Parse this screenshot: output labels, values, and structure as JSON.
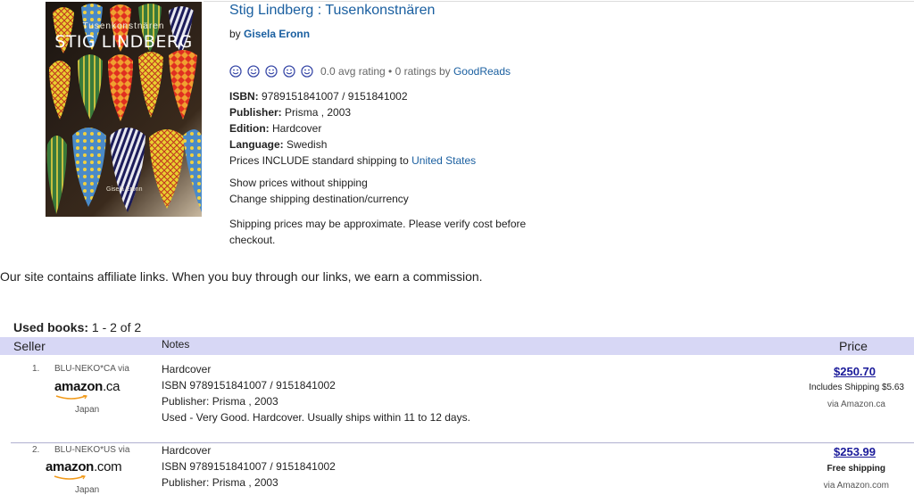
{
  "cover": {
    "subtitle": "Tusenkonstnären",
    "title": "STIG LINDBERG",
    "publisher_mark": "Gisela Eronn"
  },
  "book": {
    "title": "Stig Lindberg : Tusenkonstnären",
    "by_label": "by",
    "author": "Gisela Eronn",
    "rating_text": "0.0 avg rating • 0 ratings by",
    "rating_source": "GoodReads",
    "isbn_label": "ISBN:",
    "isbn": "9789151841007 / 9151841002",
    "publisher_label": "Publisher:",
    "publisher": "Prisma , 2003",
    "edition_label": "Edition:",
    "edition": "Hardcover",
    "language_label": "Language:",
    "language": "Swedish",
    "shipping_text": "Prices INCLUDE standard shipping to",
    "shipping_country": "United States",
    "link_no_shipping": "Show prices without shipping",
    "link_change_dest": "Change shipping destination/currency",
    "shipping_note": "Shipping prices may be approximate. Please verify cost before checkout."
  },
  "affiliate_note": "Our site contains affiliate links. When you buy through our links, we earn a commission.",
  "used": {
    "label": "Used books:",
    "range": "1 - 2 of 2",
    "columns": {
      "seller": "Seller",
      "notes": "Notes",
      "price": "Price"
    },
    "rows": [
      {
        "num": "1.",
        "seller": "BLU-NEKO*CA via",
        "logo_main": "amazon",
        "logo_tld": ".ca",
        "country": "Japan",
        "binding": "Hardcover",
        "isbn": "ISBN 9789151841007 / 9151841002",
        "publisher": "Publisher: Prisma , 2003",
        "condition": "Used - Very Good. Hardcover. Usually ships within 11 to 12 days.",
        "price": "$250.70",
        "shipping": "Includes Shipping $5.63",
        "via": "via Amazon.ca"
      },
      {
        "num": "2.",
        "seller": "BLU-NEKO*US via",
        "logo_main": "amazon",
        "logo_tld": ".com",
        "country": "Japan",
        "binding": "Hardcover",
        "isbn": "ISBN 9789151841007 / 9151841002",
        "publisher": "Publisher: Prisma , 2003",
        "price": "$253.99",
        "shipping": "Free shipping",
        "via": "via Amazon.com"
      }
    ]
  },
  "colors": {
    "link": "#1a5fa0",
    "header_band": "#d7d7f5",
    "price": "#1a1a9a"
  },
  "icons": {
    "rating": "smiley-face-icon"
  }
}
